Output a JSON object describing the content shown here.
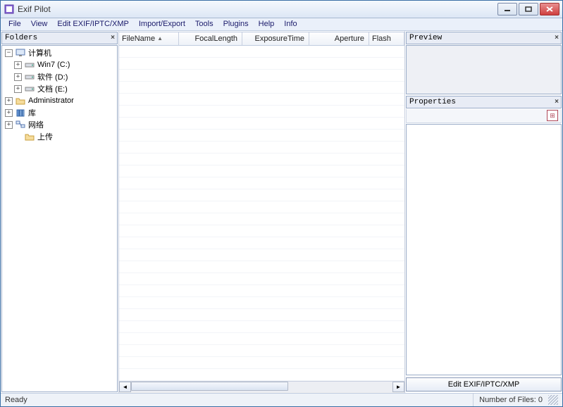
{
  "window": {
    "title": "Exif Pilot"
  },
  "menu": {
    "file": "File",
    "view": "View",
    "edit_meta": "Edit EXIF/IPTC/XMP",
    "import_export": "Import/Export",
    "tools": "Tools",
    "plugins": "Plugins",
    "help": "Help",
    "info": "Info"
  },
  "panels": {
    "folders": "Folders",
    "preview": "Preview",
    "properties": "Properties"
  },
  "tree": {
    "computer": "计算机",
    "win7": "Win7 (C:)",
    "soft": "软件 (D:)",
    "docs": "文档 (E:)",
    "admin": "Administrator",
    "lib": "库",
    "network": "网络",
    "upload": "上传"
  },
  "columns": {
    "filename": "FileName",
    "focal": "FocalLength",
    "exposure": "ExposureTime",
    "aperture": "Aperture",
    "flash": "Flash"
  },
  "buttons": {
    "edit_meta": "Edit EXIF/IPTC/XMP"
  },
  "status": {
    "ready": "Ready",
    "filecount": "Number of Files: 0"
  }
}
